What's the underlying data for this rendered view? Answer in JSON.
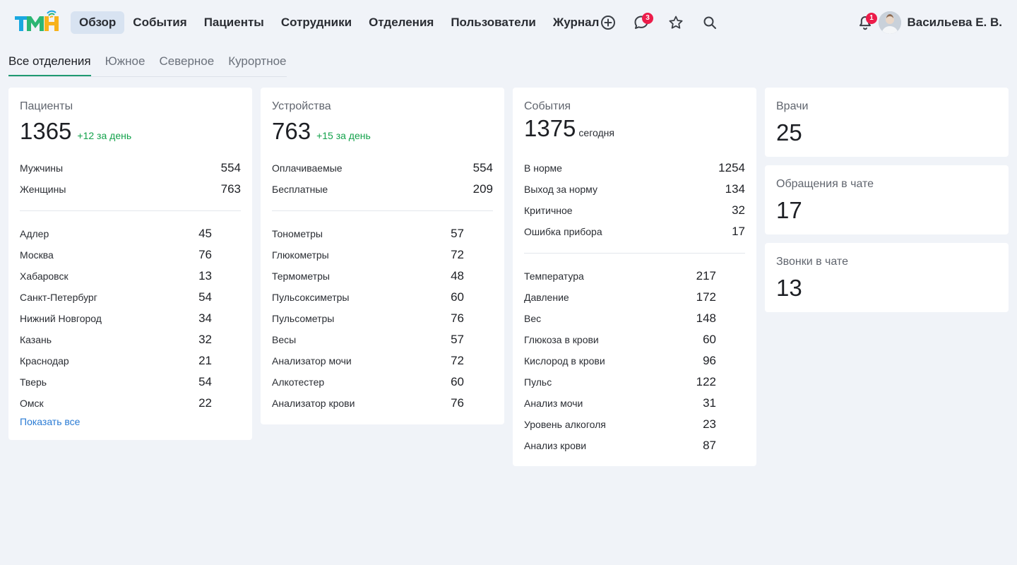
{
  "header": {
    "logo_text": "ТМ",
    "nav": [
      "Обзор",
      "События",
      "Пациенты",
      "Сотрудники",
      "Отделения",
      "Пользователи",
      "Журнал"
    ],
    "messages_badge": "3",
    "notifications_badge": "1",
    "user_name": "Васильева Е. В."
  },
  "tabs": [
    "Все отделения",
    "Южное",
    "Северное",
    "Курортное"
  ],
  "patients": {
    "title": "Пациенты",
    "total": "1365",
    "delta": "+12 за день",
    "gender": [
      {
        "label": "Мужчины",
        "value": "554"
      },
      {
        "label": "Женщины",
        "value": "763"
      }
    ],
    "cities": [
      {
        "label": "Адлер",
        "value": "45"
      },
      {
        "label": "Москва",
        "value": "76"
      },
      {
        "label": "Хабаровск",
        "value": "13"
      },
      {
        "label": "Санкт-Петербург",
        "value": "54"
      },
      {
        "label": "Нижний Новгород",
        "value": "34"
      },
      {
        "label": "Казань",
        "value": "32"
      },
      {
        "label": "Краснодар",
        "value": "21"
      },
      {
        "label": "Тверь",
        "value": "54"
      },
      {
        "label": "Омск",
        "value": "22"
      }
    ],
    "show_all": "Показать все"
  },
  "devices": {
    "title": "Устройства",
    "total": "763",
    "delta": "+15 за день",
    "billing": [
      {
        "label": "Оплачиваемые",
        "value": "554"
      },
      {
        "label": "Бесплатные",
        "value": "209"
      }
    ],
    "types": [
      {
        "label": "Тонометры",
        "value": "57"
      },
      {
        "label": "Глюкометры",
        "value": "72"
      },
      {
        "label": "Термометры",
        "value": "48"
      },
      {
        "label": "Пульсоксиметры",
        "value": "60"
      },
      {
        "label": "Пульсометры",
        "value": "76"
      },
      {
        "label": "Весы",
        "value": "57"
      },
      {
        "label": "Анализатор мочи",
        "value": "72"
      },
      {
        "label": "Алкотестер",
        "value": "60"
      },
      {
        "label": "Анализатор крови",
        "value": "76"
      }
    ]
  },
  "events": {
    "title": "События",
    "total": "1375",
    "suffix": "сегодня",
    "status": [
      {
        "label": "В норме",
        "value": "1254"
      },
      {
        "label": "Выход за норму",
        "value": "134"
      },
      {
        "label": "Критичное",
        "value": "32"
      },
      {
        "label": "Ошибка прибора",
        "value": "17"
      }
    ],
    "types": [
      {
        "label": "Температура",
        "value": "217"
      },
      {
        "label": "Давление",
        "value": "172"
      },
      {
        "label": "Вес",
        "value": "148"
      },
      {
        "label": "Глюкоза в крови",
        "value": "60"
      },
      {
        "label": "Кислород в крови",
        "value": "96"
      },
      {
        "label": "Пульс",
        "value": "122"
      },
      {
        "label": "Анализ мочи",
        "value": "31"
      },
      {
        "label": "Уровень алкоголя",
        "value": "23"
      },
      {
        "label": "Анализ крови",
        "value": "87"
      }
    ]
  },
  "doctors": {
    "title": "Врачи",
    "value": "25"
  },
  "chat_requests": {
    "title": "Обращения в чате",
    "value": "17"
  },
  "chat_calls": {
    "title": "Звонки в чате",
    "value": "13"
  }
}
